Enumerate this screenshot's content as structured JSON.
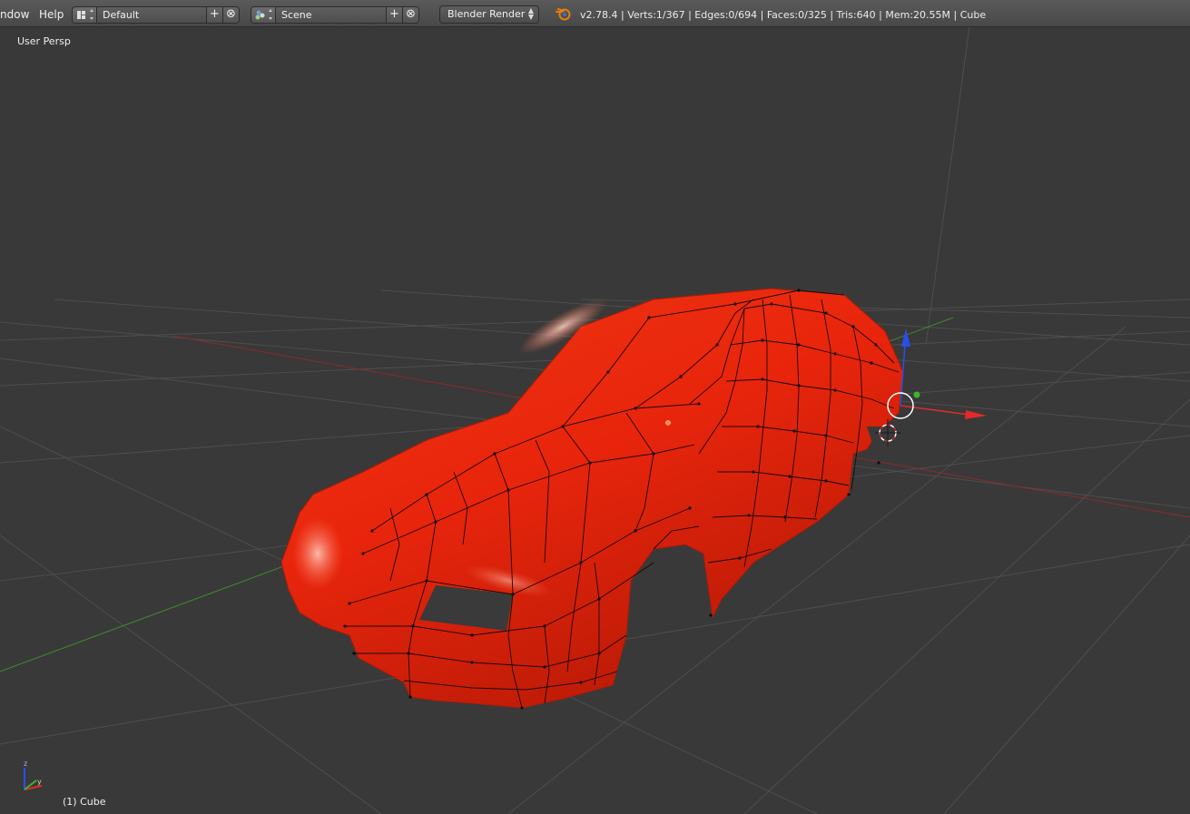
{
  "header": {
    "menus": [
      "ndow",
      "Help"
    ],
    "layout": {
      "icon": "screen-layout-icon",
      "value": "Default"
    },
    "scene": {
      "icon": "scene-icon",
      "value": "Scene"
    },
    "engine": "Blender Render",
    "stats": "v2.78.4 | Verts:1/367 | Edges:0/694 | Faces:0/325 | Tris:640 | Mem:20.55M | Cube",
    "add_glyph": "+",
    "remove_glyph": "⊗"
  },
  "viewport": {
    "view_label": "User Persp",
    "object_label": "(1) Cube",
    "mesh_color": "#e8250c",
    "background": "#393939",
    "axis_colors": {
      "x": "#e22a2a",
      "y": "#46b52f",
      "z": "#2a4fe8"
    }
  }
}
